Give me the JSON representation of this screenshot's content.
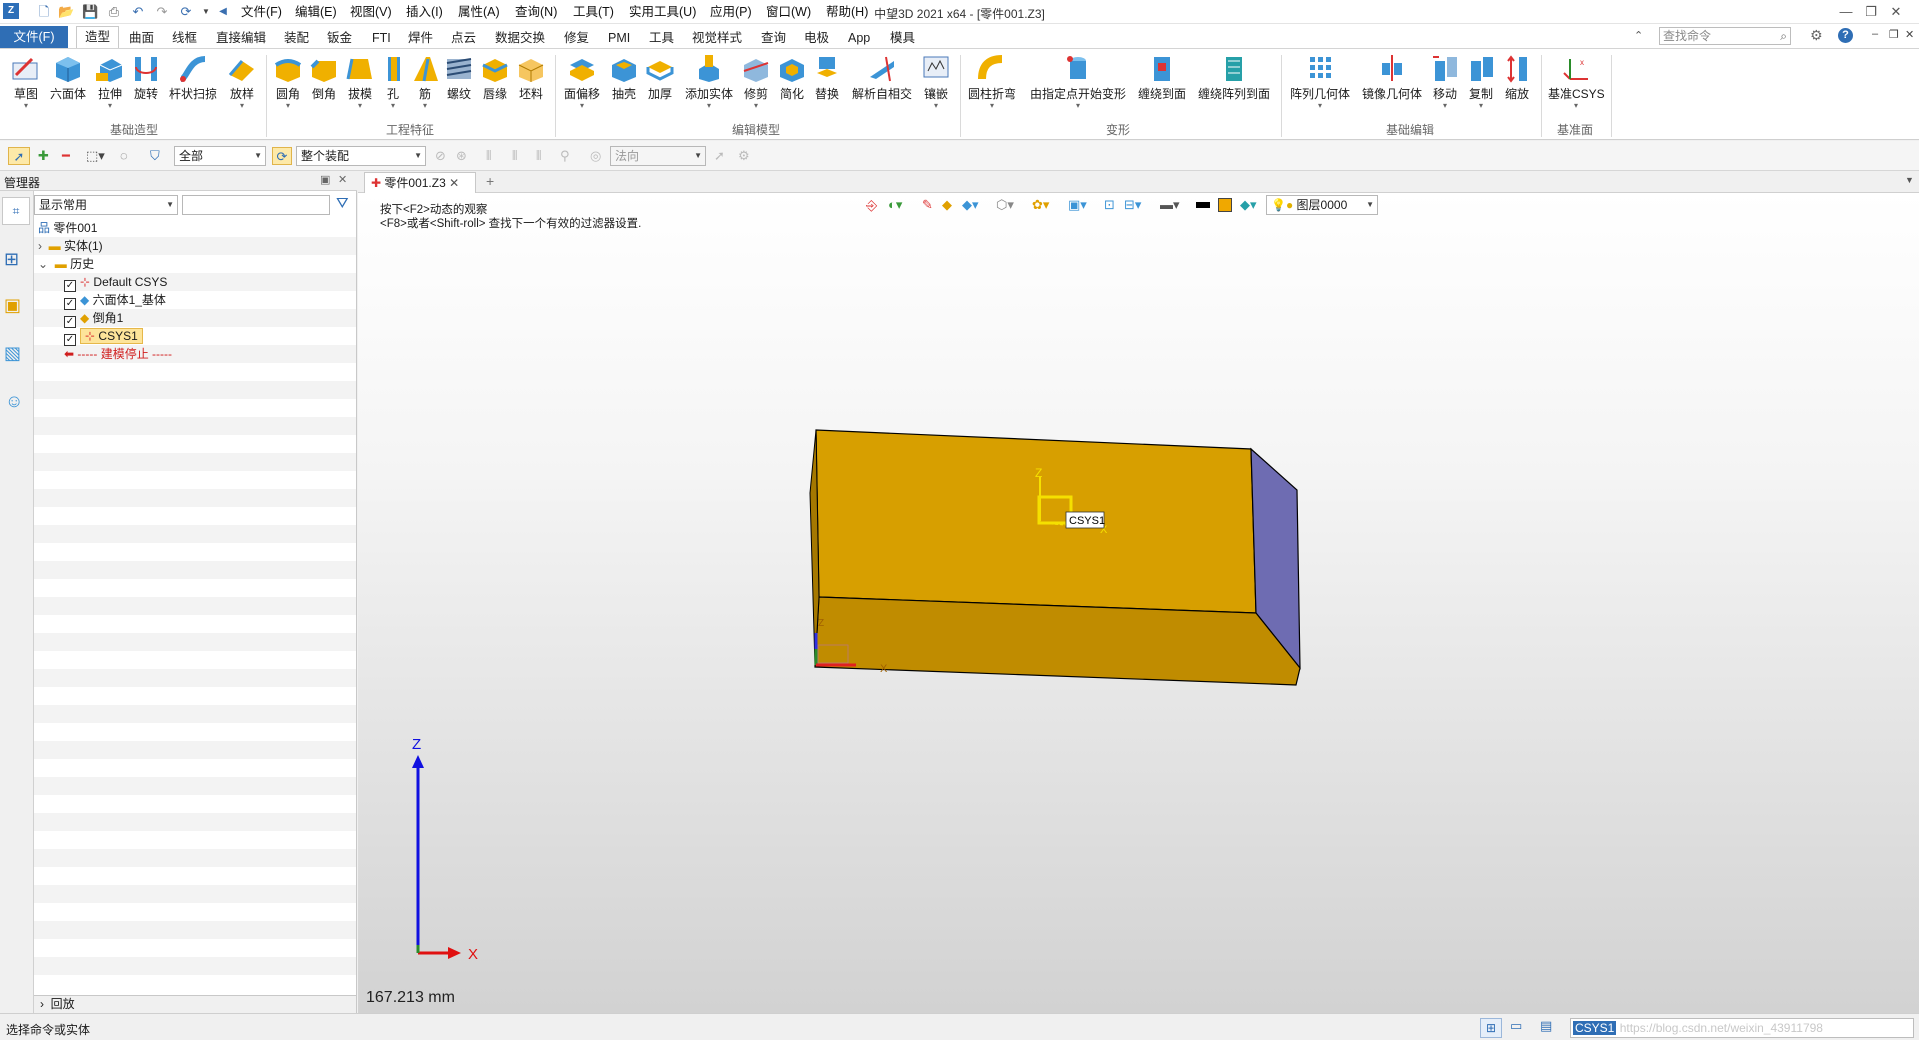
{
  "title": "中望3D 2021 x64 - [零件001.Z3]",
  "menu": [
    "文件(F)",
    "编辑(E)",
    "视图(V)",
    "插入(I)",
    "属性(A)",
    "查询(N)",
    "工具(T)",
    "实用工具(U)",
    "应用(P)",
    "窗口(W)",
    "帮助(H)"
  ],
  "ribbon_tabs": {
    "file": "文件(F)",
    "items": [
      "造型",
      "曲面",
      "线框",
      "直接编辑",
      "装配",
      "钣金",
      "FTI",
      "焊件",
      "点云",
      "数据交换",
      "修复",
      "PMI",
      "工具",
      "视觉样式",
      "查询",
      "电极",
      "App",
      "模具"
    ],
    "active": "造型"
  },
  "search_placeholder": "查找命令",
  "ribbon": {
    "buttons": [
      "草图",
      "六面体",
      "拉伸",
      "旋转",
      "杆状扫掠",
      "放样",
      "圆角",
      "倒角",
      "拔模",
      "孔",
      "筋",
      "螺纹",
      "唇缘",
      "坯料",
      "面偏移",
      "抽壳",
      "加厚",
      "添加实体",
      "修剪",
      "简化",
      "替换",
      "解析自相交",
      "镶嵌",
      "圆柱折弯",
      "由指定点开始变形",
      "缠绕到面",
      "缠绕阵列到面",
      "阵列几何体",
      "镜像几何体",
      "移动",
      "复制",
      "缩放",
      "基准CSYS"
    ],
    "groups": [
      "基础造型",
      "工程特征",
      "编辑模型",
      "变形",
      "基础编辑",
      "基准面"
    ]
  },
  "filter": {
    "scope": "全部",
    "assembly": "整个装配",
    "direction": "法向"
  },
  "manager": {
    "title": "管理器",
    "display": "显示常用",
    "tree": {
      "root": "零件001",
      "solid": "实体(1)",
      "history": "历史",
      "items": [
        "Default CSYS",
        "六面体1_基体",
        "倒角1",
        "CSYS1"
      ],
      "stop": "----- 建模停止 -----"
    },
    "replay": "回放"
  },
  "doc_tab": "零件001.Z3",
  "hints": [
    "按下<F2>动态的观察",
    "<F8>或者<Shift-roll> 查找下一个有效的过滤器设置."
  ],
  "view_toolbar": {
    "layer": "图层0000",
    "colors": {
      "black": "#000000",
      "orange": "#f0a800"
    }
  },
  "model": {
    "csys_label": "CSYS1",
    "axes": {
      "x": "X",
      "y": "Y",
      "z": "Z"
    },
    "colors": {
      "face": "#d79f00",
      "side": "#6e6cb2"
    }
  },
  "measure": "167.213 mm",
  "status": {
    "prompt": "选择命令或实体",
    "input": "CSYS1",
    "watermark": "https://blog.csdn.net/weixin_43911798"
  }
}
